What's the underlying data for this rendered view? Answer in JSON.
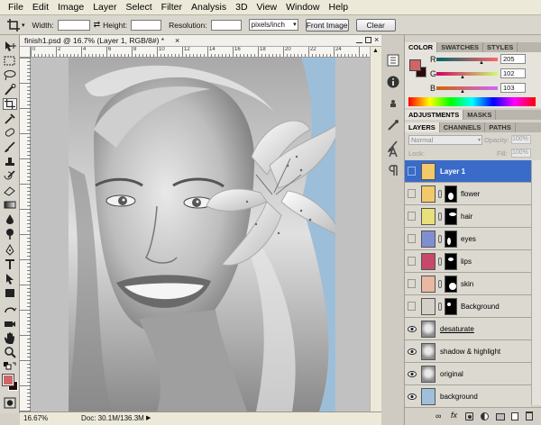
{
  "menubar": {
    "items": [
      "File",
      "Edit",
      "Image",
      "Layer",
      "Select",
      "Filter",
      "Analysis",
      "3D",
      "View",
      "Window",
      "Help"
    ]
  },
  "options": {
    "width_label": "Width:",
    "height_label": "Height:",
    "resolution_label": "Resolution:",
    "width_value": "",
    "height_value": "",
    "resolution_value": "",
    "unit": "pixels/inch",
    "front_image_label": "Front Image",
    "clear_label": "Clear"
  },
  "document": {
    "tab_title": "finish1.psd @ 16.7% (Layer 1, RGB/8#) *",
    "close_glyph": "×",
    "ruler_ticks": [
      "0",
      "2",
      "4",
      "6",
      "8",
      "10",
      "12",
      "14",
      "16",
      "18",
      "20",
      "22",
      "24"
    ],
    "zoom": "16.67%",
    "doc_info": "Doc: 30.1M/136.3M"
  },
  "color_panel": {
    "tabs": [
      "COLOR",
      "SWATCHES",
      "STYLES"
    ],
    "active_tab": "COLOR",
    "r_label": "R",
    "g_label": "G",
    "b_label": "B",
    "r_value": "205",
    "g_value": "102",
    "b_value": "103",
    "foreground": "#cd6667",
    "background": "#2a0a0a"
  },
  "adjustments_panel": {
    "tabs": [
      "ADJUSTMENTS",
      "MASKS"
    ],
    "active_tab": "ADJUSTMENTS"
  },
  "layers_panel": {
    "tabs": [
      "LAYERS",
      "CHANNELS",
      "PATHS"
    ],
    "active_tab": "LAYERS",
    "blend_mode": "Normal",
    "opacity_label": "Opacity:",
    "opacity_value": "100%",
    "fill_label": "Fill:",
    "fill_value": "100%",
    "lock_label": "Lock:",
    "layers": [
      {
        "name": "Layer 1",
        "color": "#f2c86a",
        "selected": true,
        "visible": false,
        "mask": false
      },
      {
        "name": "flower",
        "color": "#f2c86a",
        "selected": false,
        "visible": false,
        "mask": true
      },
      {
        "name": "hair",
        "color": "#e8e07a",
        "selected": false,
        "visible": false,
        "mask": true
      },
      {
        "name": "eyes",
        "color": "#7f8fd0",
        "selected": false,
        "visible": false,
        "mask": true
      },
      {
        "name": "lips",
        "color": "#c8486a",
        "selected": false,
        "visible": false,
        "mask": true
      },
      {
        "name": "skin",
        "color": "#e8b8a0",
        "selected": false,
        "visible": false,
        "mask": true
      },
      {
        "name": "Background",
        "color": "#d4d0c8",
        "selected": false,
        "visible": false,
        "mask": true
      },
      {
        "name": "desaturate",
        "color": "#9a9a9a",
        "selected": false,
        "visible": true,
        "mask": false
      },
      {
        "name": "shadow & highlight",
        "color": "#9a9a9a",
        "selected": false,
        "visible": true,
        "mask": false
      },
      {
        "name": "original",
        "color": "#9a9a9a",
        "selected": false,
        "visible": true,
        "mask": false
      },
      {
        "name": "background",
        "color": "#9fc0db",
        "selected": false,
        "visible": true,
        "mask": false
      }
    ]
  }
}
